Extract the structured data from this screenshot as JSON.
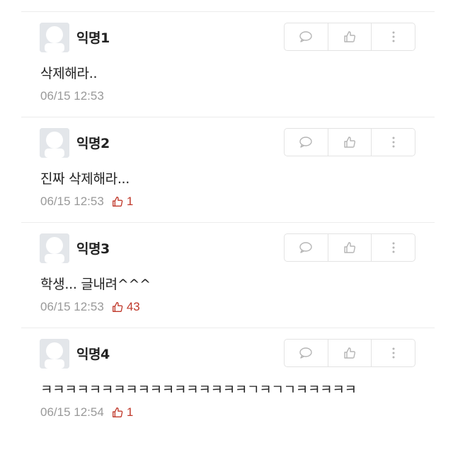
{
  "comments": [
    {
      "author": "익명1",
      "text": "삭제해라..",
      "time": "06/15 12:53",
      "likes": ""
    },
    {
      "author": "익명2",
      "text": "진짜 삭제해라...",
      "time": "06/15 12:53",
      "likes": "1"
    },
    {
      "author": "익명3",
      "text": "학생... 글내려^^^",
      "time": "06/15 12:53",
      "likes": "43"
    },
    {
      "author": "익명4",
      "text": "ㅋㅋㅋㅋㅋㅋㅋㅋㅋㅋㅋㅋㅋㅋㅋㅋㅋㄱㅋㄱㄱㅋㅋㅋㅋㅋ",
      "time": "06/15 12:54",
      "likes": "1"
    }
  ],
  "icons": {
    "reply": "speech-bubble-icon",
    "like": "thumbs-up-icon",
    "more": "more-vertical-icon",
    "avatar": "default-avatar-icon"
  },
  "colors": {
    "like_count": "#c0392b",
    "meta_text": "#999999",
    "divider": "#ececec"
  }
}
